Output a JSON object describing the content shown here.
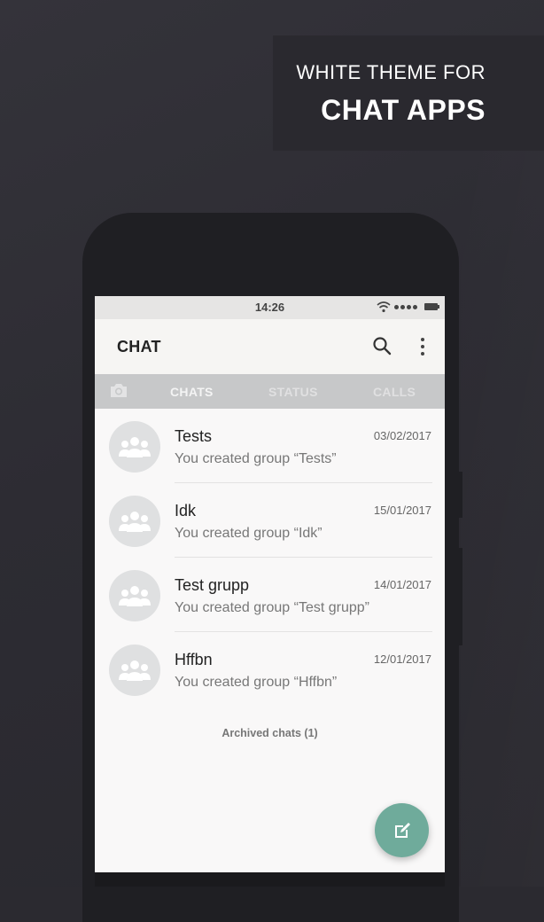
{
  "promo": {
    "subtitle": "WHITE THEME FOR",
    "title": "CHAT APPS"
  },
  "status_bar": {
    "time": "14:26"
  },
  "app_bar": {
    "title": "CHAT",
    "icons": [
      "search-icon",
      "more-vert-icon"
    ]
  },
  "tabs": {
    "camera_icon": "camera-icon",
    "chats": "CHATS",
    "status": "STATUS",
    "calls": "CALLS"
  },
  "chats": [
    {
      "name": "Tests",
      "date": "03/02/2017",
      "preview": "You created group “Tests”"
    },
    {
      "name": "Idk",
      "date": "15/01/2017",
      "preview": "You created group “Idk”"
    },
    {
      "name": "Test grupp",
      "date": "14/01/2017",
      "preview": "You created group “Test grupp”"
    },
    {
      "name": "Hffbn",
      "date": "12/01/2017",
      "preview": "You created group “Hffbn”"
    }
  ],
  "archived": "Archived chats (1)",
  "fab_icon": "compose-icon",
  "colors": {
    "accent": "#6fab9b",
    "tab_bar": "#c7c8c9",
    "background": "#2b2a30"
  }
}
